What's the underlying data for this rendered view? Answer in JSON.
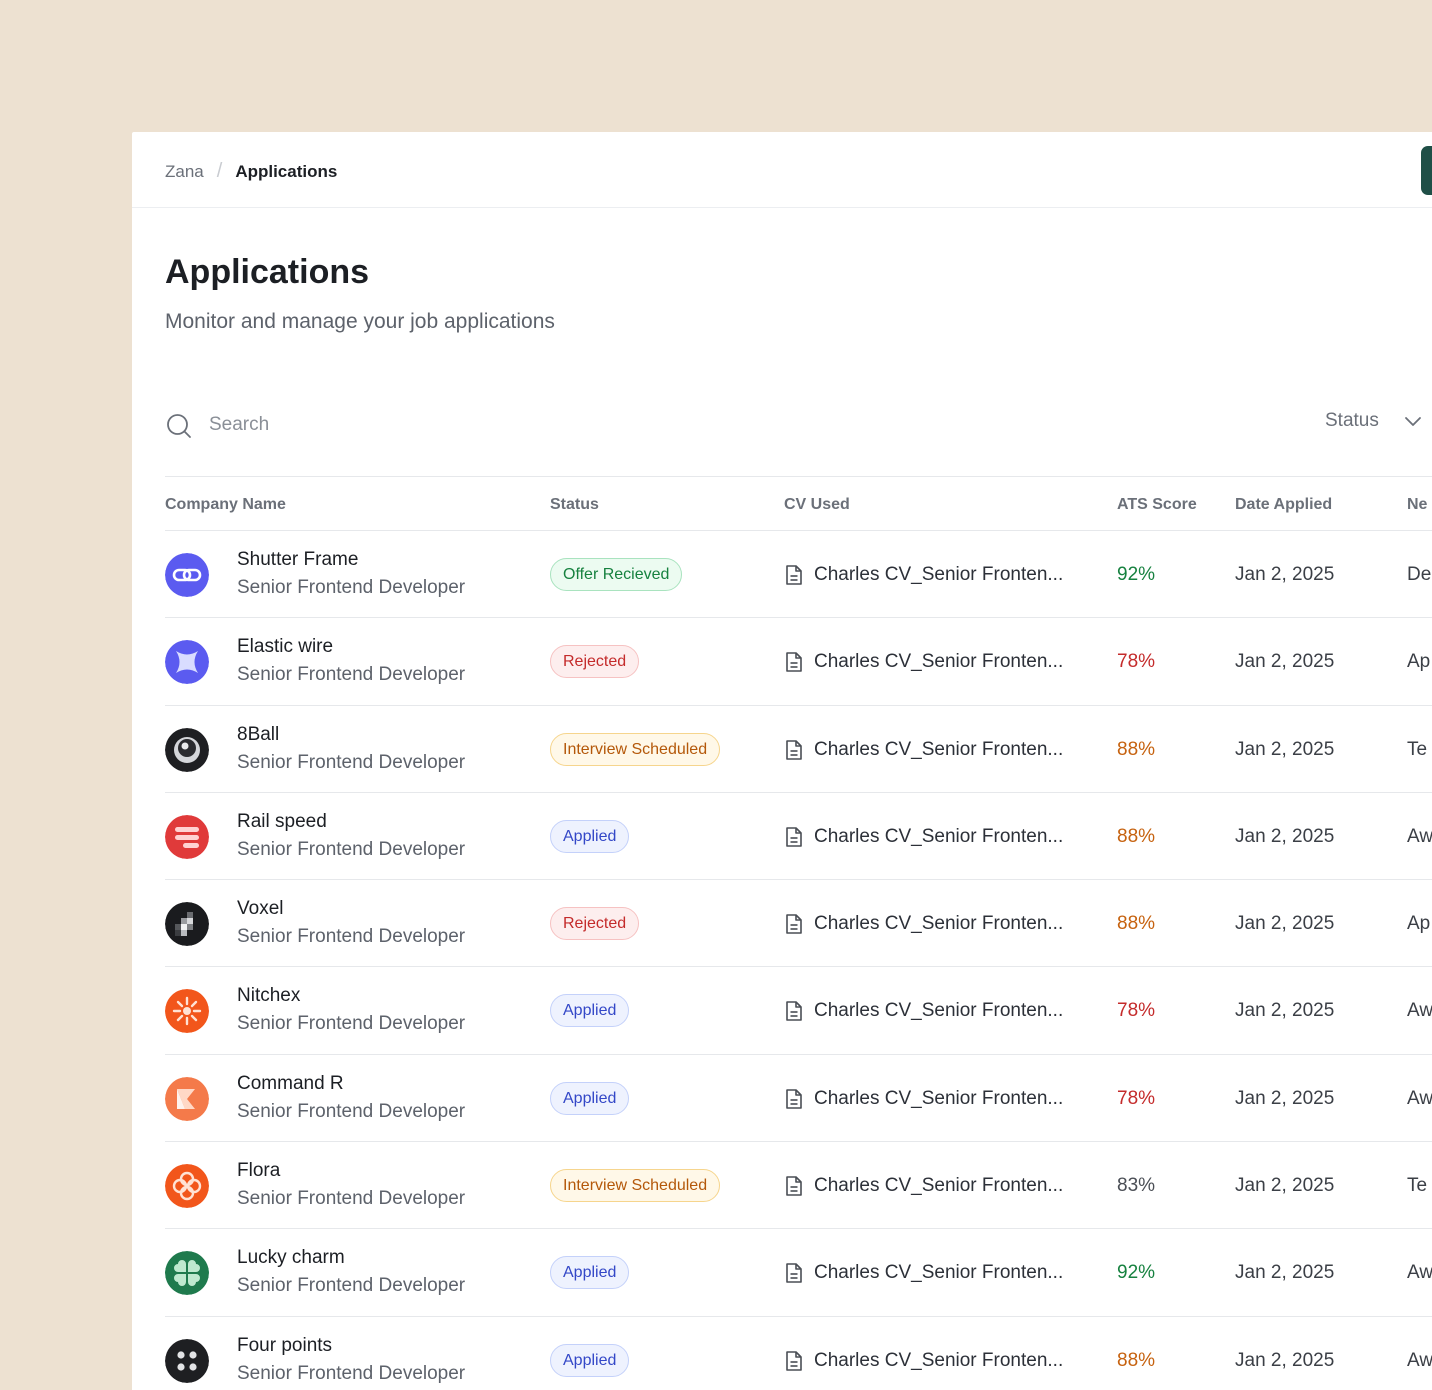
{
  "breadcrumb": {
    "root": "Zana",
    "separator": "/",
    "current": "Applications"
  },
  "page": {
    "title": "Applications",
    "subtitle": "Monitor and manage your job applications"
  },
  "search": {
    "placeholder": "Search",
    "icon": "search-icon"
  },
  "filters": {
    "status_label": "Status",
    "icon": "chevron-down-icon"
  },
  "colors": {
    "brand": "#1f4f47",
    "score_high": "#16813f",
    "score_mid": "#c6620f",
    "score_low": "#c42b2b",
    "background": "#ede1d1"
  },
  "table": {
    "headers": [
      "Company Name",
      "Status",
      "CV Used",
      "ATS Score",
      "Date Applied",
      "Ne"
    ],
    "rows": [
      {
        "name": "Shutter Frame",
        "role": "Senior Frontend Developer",
        "status": "Offer Recieved",
        "cv": "Charles CV_Senior Fronten...",
        "ats": "92%",
        "date": "Jan 2, 2025",
        "next": "De",
        "logo_icon": "chain-link-logo-icon"
      },
      {
        "name": "Elastic wire",
        "role": "Senior Frontend Developer",
        "status": "Rejected",
        "cv": "Charles CV_Senior Fronten...",
        "ats": "78%",
        "date": "Jan 2, 2025",
        "next": "Ap",
        "logo_icon": "sparkle-logo-icon"
      },
      {
        "name": "8Ball",
        "role": "Senior Frontend Developer",
        "status": "Interview Scheduled",
        "cv": "Charles CV_Senior Fronten...",
        "ats": "88%",
        "date": "Jan 2, 2025",
        "next": "Te",
        "logo_icon": "eight-ball-logo-icon"
      },
      {
        "name": "Rail speed",
        "role": "Senior Frontend Developer",
        "status": "Applied",
        "cv": "Charles CV_Senior Fronten...",
        "ats": "88%",
        "date": "Jan 2, 2025",
        "next": "Aw",
        "logo_icon": "rails-logo-icon"
      },
      {
        "name": "Voxel",
        "role": "Senior Frontend Developer",
        "status": "Rejected",
        "cv": "Charles CV_Senior Fronten...",
        "ats": "88%",
        "date": "Jan 2, 2025",
        "next": "Ap",
        "logo_icon": "pixel-logo-icon"
      },
      {
        "name": "Nitchex",
        "role": "Senior Frontend Developer",
        "status": "Applied",
        "cv": "Charles CV_Senior Fronten...",
        "ats": "78%",
        "date": "Jan 2, 2025",
        "next": "Aw",
        "logo_icon": "sunburst-logo-icon"
      },
      {
        "name": "Command R",
        "role": "Senior Frontend Developer",
        "status": "Applied",
        "cv": "Charles CV_Senior Fronten...",
        "ats": "78%",
        "date": "Jan 2, 2025",
        "next": "Aw",
        "logo_icon": "folded-shape-logo-icon"
      },
      {
        "name": "Flora",
        "role": "Senior Frontend Developer",
        "status": "Interview Scheduled",
        "cv": "Charles CV_Senior Fronten...",
        "ats": "83%",
        "date": "Jan 2, 2025",
        "next": "Te",
        "logo_icon": "flower-logo-icon"
      },
      {
        "name": "Lucky charm",
        "role": "Senior Frontend Developer",
        "status": "Applied",
        "cv": "Charles CV_Senior Fronten...",
        "ats": "92%",
        "date": "Jan 2, 2025",
        "next": "Aw",
        "logo_icon": "clover-logo-icon"
      },
      {
        "name": "Four points",
        "role": "Senior Frontend Developer",
        "status": "Applied",
        "cv": "Charles CV_Senior Fronten...",
        "ats": "88%",
        "date": "Jan 2, 2025",
        "next": "Aw",
        "logo_icon": "four-dots-logo-icon"
      }
    ]
  }
}
